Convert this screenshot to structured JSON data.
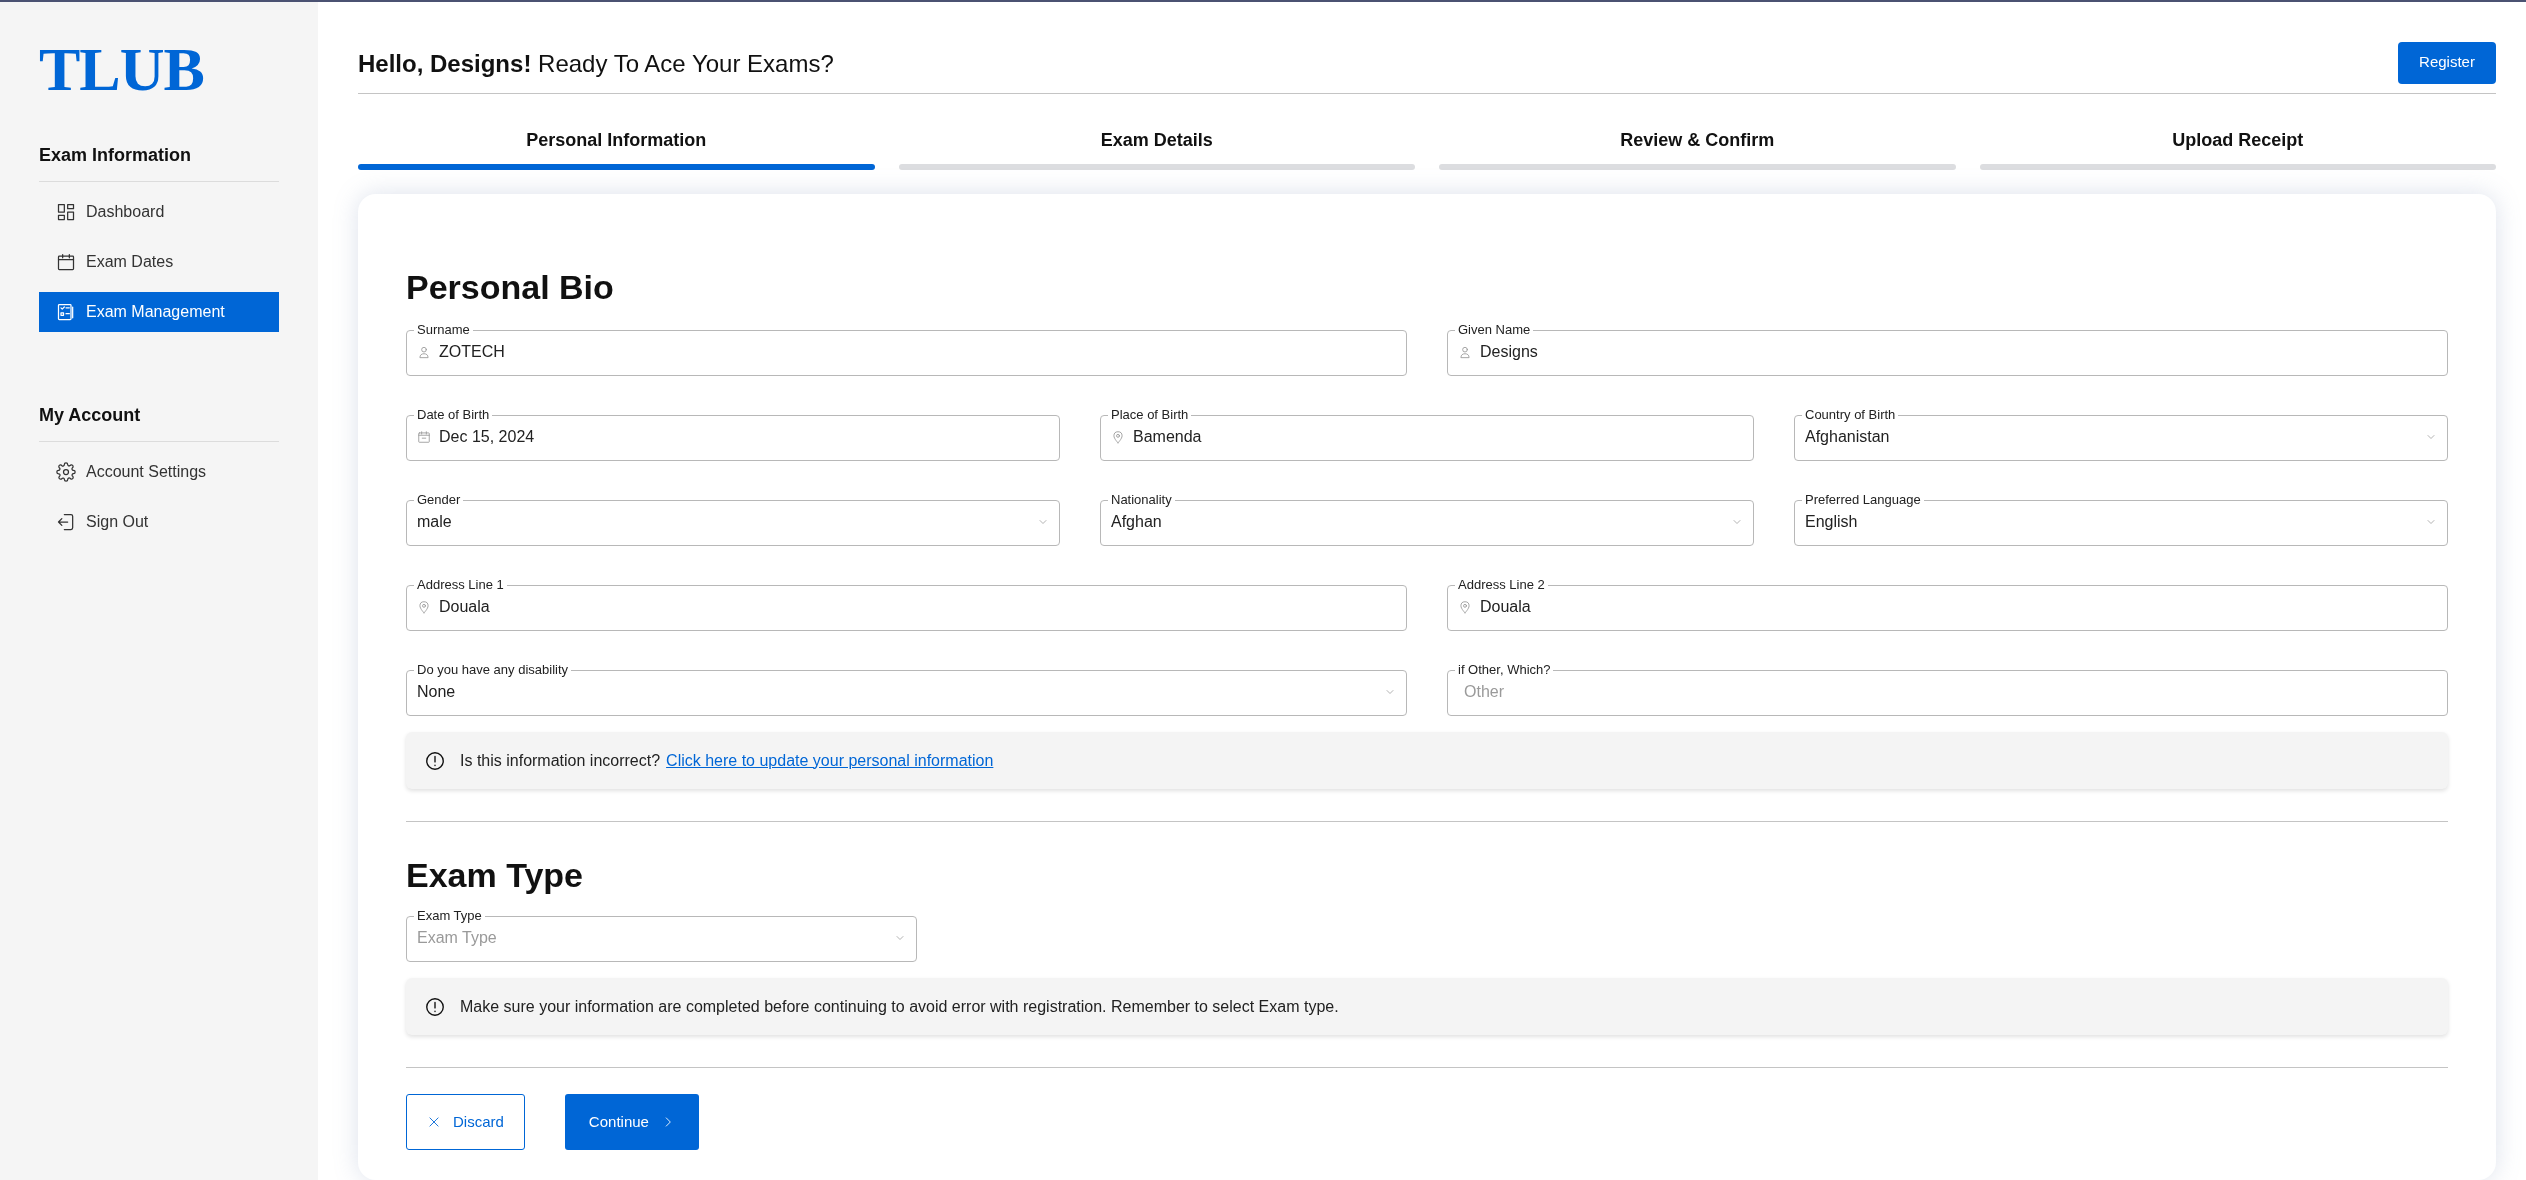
{
  "sidebar": {
    "logo": "TLUB",
    "sections": [
      {
        "title": "Exam Information",
        "items": [
          {
            "label": "Dashboard",
            "selected": false
          },
          {
            "label": "Exam Dates",
            "selected": false
          },
          {
            "label": "Exam Management",
            "selected": true
          }
        ]
      },
      {
        "title": "My Account",
        "items": [
          {
            "label": "Account Settings",
            "selected": false
          },
          {
            "label": "Sign Out",
            "selected": false
          }
        ]
      }
    ]
  },
  "header": {
    "greeting": "**Hello, Designs!** Ready To Ace Your Exams?",
    "register_button": "Register"
  },
  "steps": [
    {
      "label": "Personal Information",
      "selected": true
    },
    {
      "label": "Exam Details",
      "selected": false
    },
    {
      "label": "Review & Confirm",
      "selected": false
    },
    {
      "label": "Upload Receipt",
      "selected": false
    }
  ],
  "personal_bio": {
    "title": "Personal Bio",
    "rows": [
      [
        {
          "kind": "text",
          "label": "Surname",
          "value": "ZOTECH"
        },
        {
          "kind": "text",
          "label": "Given Name",
          "value": "Designs"
        }
      ],
      [
        {
          "kind": "text",
          "label": "Date of Birth",
          "value": "Dec 15, 2024"
        },
        {
          "kind": "text",
          "label": "Place of Birth",
          "value": "Bamenda"
        },
        {
          "kind": "select",
          "label": "Country of Birth",
          "value": "Afghanistan"
        }
      ],
      [
        {
          "kind": "select",
          "label": "Gender",
          "value": "male"
        },
        {
          "kind": "select",
          "label": "Nationality",
          "value": "Afghan"
        },
        {
          "kind": "select",
          "label": "Preferred Language",
          "value": "English"
        }
      ],
      [
        {
          "kind": "text",
          "label": "Address Line 1",
          "value": "Douala"
        },
        {
          "kind": "text",
          "label": "Address Line 2",
          "value": "Douala"
        }
      ],
      [
        {
          "kind": "select",
          "label": "Do you have any disability",
          "value": "None"
        },
        {
          "kind": "text",
          "label": "if Other, Which?",
          "placeholder": "Other"
        }
      ]
    ],
    "notice": {
      "text": "Is this information incorrect?",
      "link": "Click here to update your personal information"
    }
  },
  "exam_type": {
    "title": "Exam Type",
    "field": {
      "kind": "select",
      "label": "Exam Type",
      "placeholder": "Exam Type"
    },
    "notice": {
      "text": "Make sure your information are completed before continuing to avoid error with registration. Remember to select Exam type."
    }
  },
  "actions": [
    {
      "kind": "secondary",
      "label": "Discard"
    },
    {
      "kind": "primary",
      "label": "Continue"
    }
  ]
}
